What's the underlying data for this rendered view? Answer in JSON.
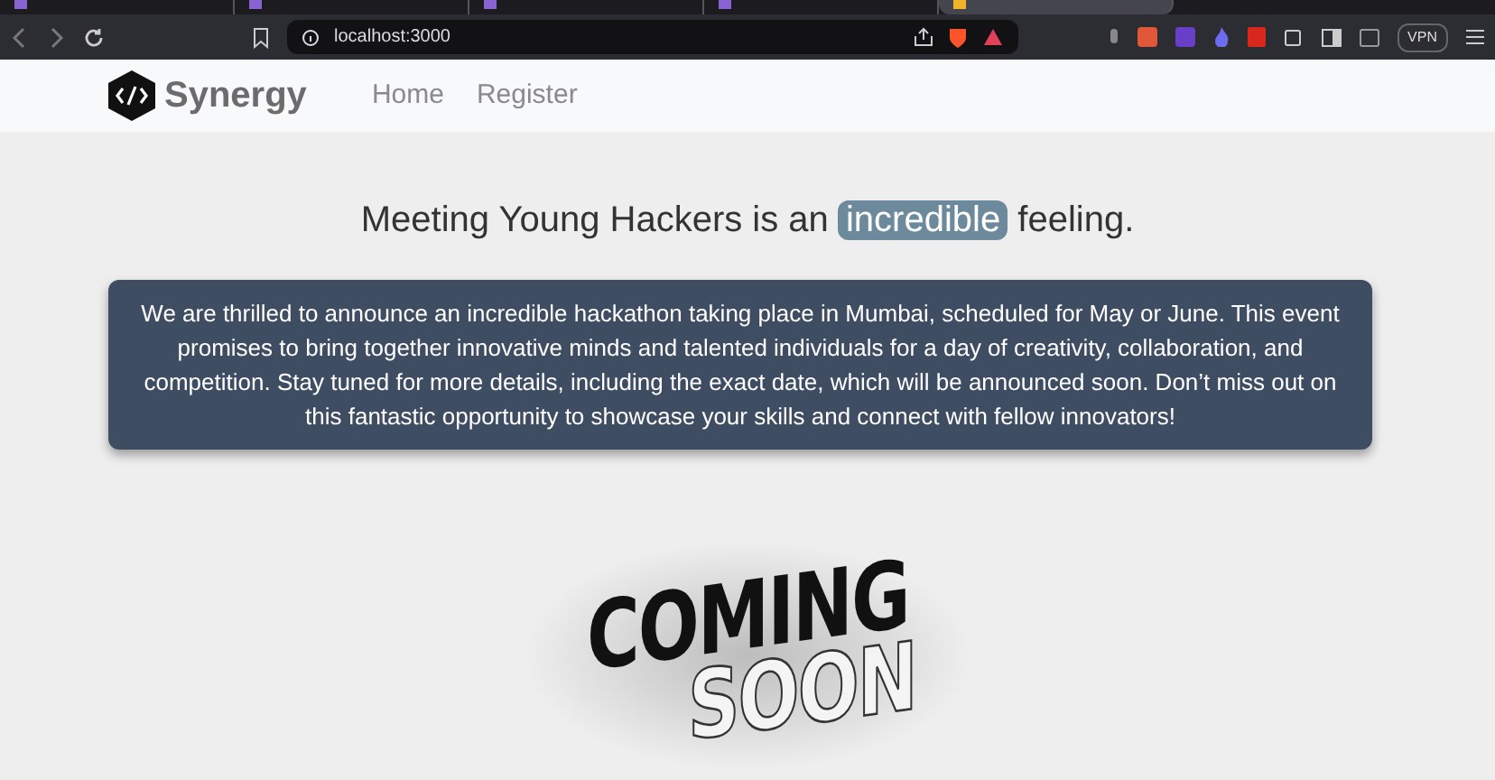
{
  "browser": {
    "tabs": [
      {
        "selected": false
      },
      {
        "selected": false
      },
      {
        "selected": false
      },
      {
        "selected": false
      },
      {
        "selected": true
      }
    ],
    "address": "localhost:3000",
    "vpn": "VPN"
  },
  "navbar": {
    "brand": "Synergy",
    "links": [
      {
        "label": "Home"
      },
      {
        "label": "Register"
      }
    ]
  },
  "headline": {
    "before": "Meeting Young Hackers is an",
    "highlight": "incredible",
    "after": "feeling."
  },
  "announcement": "We are thrilled to announce an incredible hackathon taking place in Mumbai, scheduled for May or June. This event promises to bring together innovative minds and talented individuals for a day of creativity, collaboration, and competition. Stay tuned for more details, including the exact date, which will be announced soon. Don’t miss out on this fantastic opportunity to showcase your skills and connect with fellow innovators!",
  "coming_soon": [
    "COMING",
    "SOON"
  ]
}
